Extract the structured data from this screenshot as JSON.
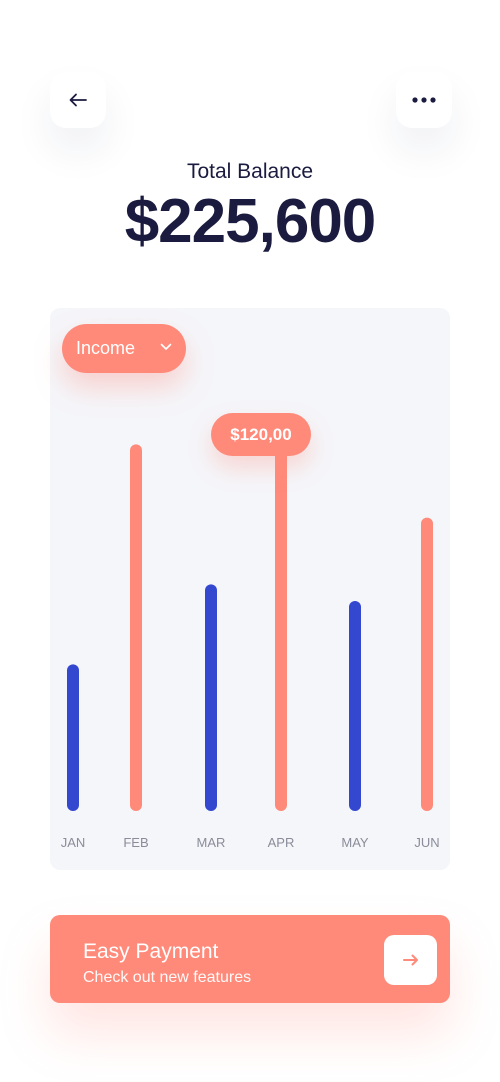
{
  "header": {
    "back_icon": "arrow-left-icon",
    "more_icon": "more-horizontal-icon"
  },
  "balance": {
    "label": "Total Balance",
    "amount": "$225,600"
  },
  "chart": {
    "dropdown": {
      "selected": "Income",
      "icon": "chevron-down-icon"
    },
    "tooltip": "$120,00",
    "highlight_index": 3
  },
  "chart_data": {
    "type": "bar",
    "categories": [
      "JAN",
      "FEB",
      "MAR",
      "APR",
      "MAY",
      "JUN"
    ],
    "values": [
      44,
      110,
      68,
      115,
      63,
      88
    ],
    "ylim": [
      0,
      120
    ],
    "grid": false,
    "colors": [
      "#3347cf",
      "#ff8a7a",
      "#3347cf",
      "#ff8a7a",
      "#3347cf",
      "#ff8a7a"
    ]
  },
  "colors": {
    "accent": "#ff8a7a",
    "secondary": "#3347cf",
    "text": "#1a1b3f",
    "card": "#f5f6fa"
  },
  "promo": {
    "title": "Easy Payment",
    "subtitle": "Check out new features",
    "icon": "arrow-right-icon"
  }
}
